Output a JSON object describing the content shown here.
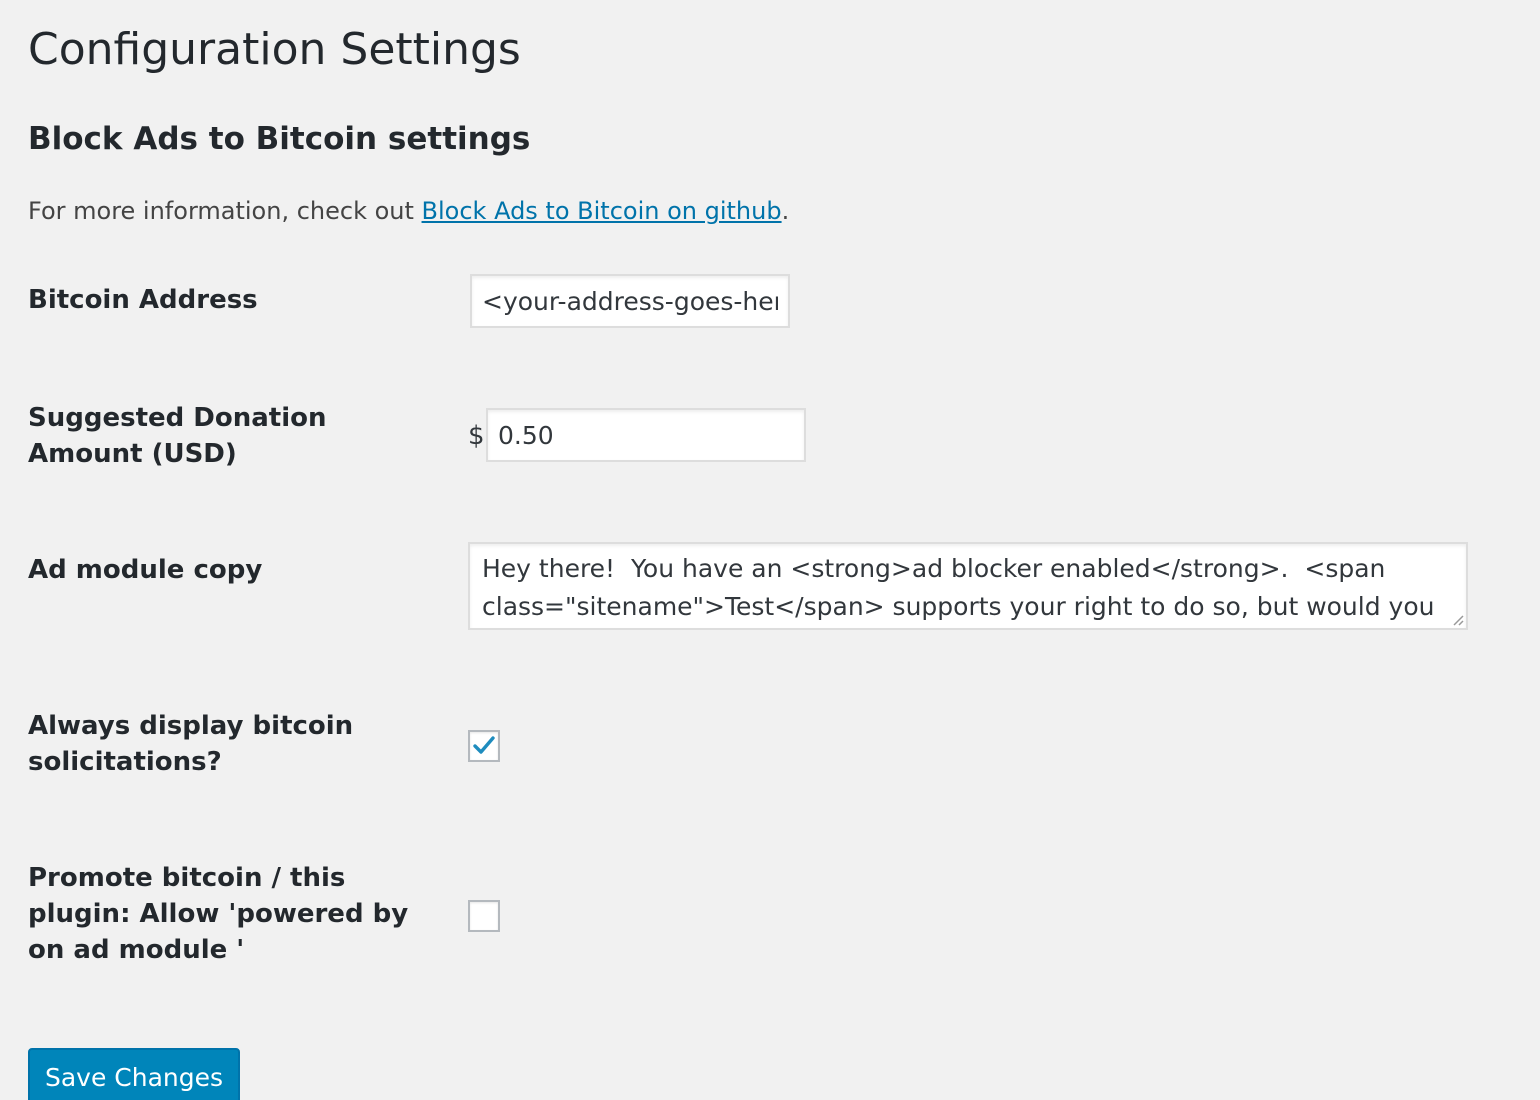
{
  "page": {
    "title": "Configuration Settings",
    "section_title": "Block Ads to Bitcoin settings",
    "intro_prefix": "For more information, check out ",
    "intro_link": "Block Ads to Bitcoin on github",
    "intro_suffix": "."
  },
  "fields": {
    "bitcoin_address": {
      "label": "Bitcoin Address",
      "value": "<your-address-goes-here>"
    },
    "donation": {
      "label": "Suggested Donation Amount (USD)",
      "currency_symbol": "$",
      "value": "0.50"
    },
    "ad_copy": {
      "label": "Ad module copy",
      "value": "Hey there!  You have an <strong>ad blocker enabled</strong>.  <span class=\"sitename\">Test</span> supports your right to do so, but would you"
    },
    "always_display": {
      "label": "Always display bitcoin solicitations?",
      "checked": true
    },
    "promote": {
      "label": "Promote bitcoin / this plugin: Allow 'powered by on ad module '",
      "checked": false
    }
  },
  "actions": {
    "save_label": "Save Changes"
  },
  "colors": {
    "background": "#f1f1f1",
    "link": "#0073aa",
    "primary_button": "#0085ba",
    "checkmark": "#1e8cbe"
  }
}
